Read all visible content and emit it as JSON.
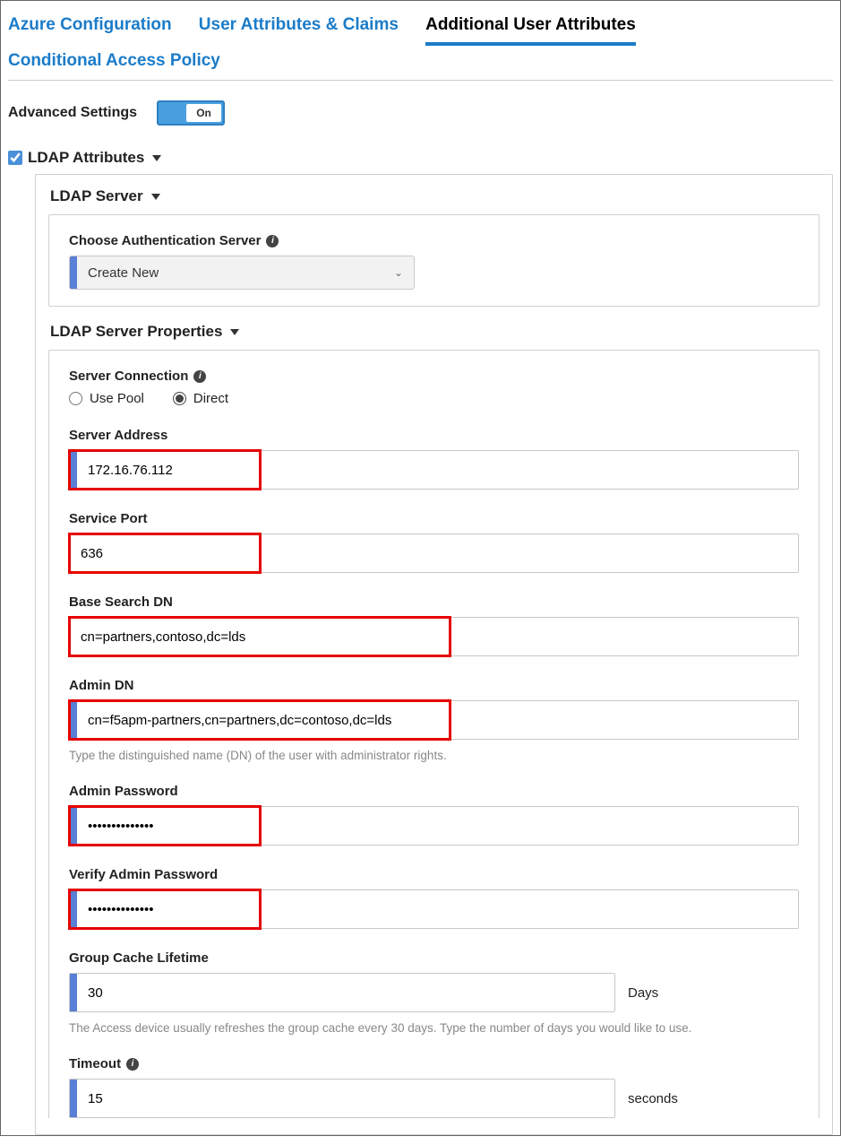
{
  "tabs": {
    "azure": "Azure Configuration",
    "claims": "User Attributes & Claims",
    "additional": "Additional User Attributes",
    "policy": "Conditional Access Policy"
  },
  "advanced": {
    "label": "Advanced Settings",
    "state": "On"
  },
  "ldap_attributes": {
    "title": "LDAP Attributes",
    "checked": true
  },
  "ldap_server": {
    "title": "LDAP Server",
    "choose_label": "Choose Authentication Server",
    "choose_value": "Create New"
  },
  "props": {
    "title": "LDAP Server Properties",
    "connection": {
      "label": "Server Connection",
      "pool": "Use Pool",
      "direct": "Direct"
    },
    "server_address": {
      "label": "Server Address",
      "value": "172.16.76.112"
    },
    "service_port": {
      "label": "Service Port",
      "value": "636"
    },
    "base_dn": {
      "label": "Base Search DN",
      "value": "cn=partners,contoso,dc=lds"
    },
    "admin_dn": {
      "label": "Admin DN",
      "value": "cn=f5apm-partners,cn=partners,dc=contoso,dc=lds",
      "helper": "Type the distinguished name (DN) of the user with administrator rights."
    },
    "admin_pw": {
      "label": "Admin Password",
      "value": "••••••••••••••"
    },
    "verify_pw": {
      "label": "Verify Admin Password",
      "value": "••••••••••••••"
    },
    "cache": {
      "label": "Group Cache Lifetime",
      "value": "30",
      "unit": "Days",
      "helper": "The Access device usually refreshes the group cache every 30 days. Type the number of days you would like to use."
    },
    "timeout": {
      "label": "Timeout",
      "value": "15",
      "unit": "seconds"
    }
  }
}
